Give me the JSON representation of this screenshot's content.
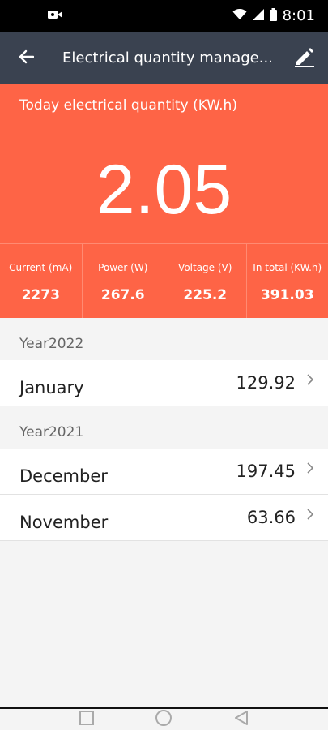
{
  "status_bar": {
    "time": "8:01",
    "icons": [
      "video-record-icon",
      "wifi-icon",
      "signal-icon",
      "battery-icon"
    ]
  },
  "app_bar": {
    "title": "Electrical quantity manage...",
    "back_icon": "arrow-left-icon",
    "edit_icon": "pencil-icon"
  },
  "today": {
    "label": "Today electrical quantity (KW.h)",
    "value": "2.05"
  },
  "stats": [
    {
      "label": "Current (mA)",
      "value": "2273"
    },
    {
      "label": "Power (W)",
      "value": "267.6"
    },
    {
      "label": "Voltage (V)",
      "value": "225.2"
    },
    {
      "label": "In total (KW.h)",
      "value": "391.03"
    }
  ],
  "years": [
    {
      "label": "Year2022",
      "months": [
        {
          "name": "January",
          "value": "129.92"
        }
      ]
    },
    {
      "label": "Year2021",
      "months": [
        {
          "name": "December",
          "value": "197.45"
        },
        {
          "name": "November",
          "value": "63.66"
        }
      ]
    }
  ],
  "colors": {
    "accent": "#fe6446",
    "app_bar": "#3a4250",
    "status_bar": "#000000"
  },
  "nav_bar": {
    "icons": [
      "recent-apps-icon",
      "home-icon",
      "back-triangle-icon"
    ]
  }
}
